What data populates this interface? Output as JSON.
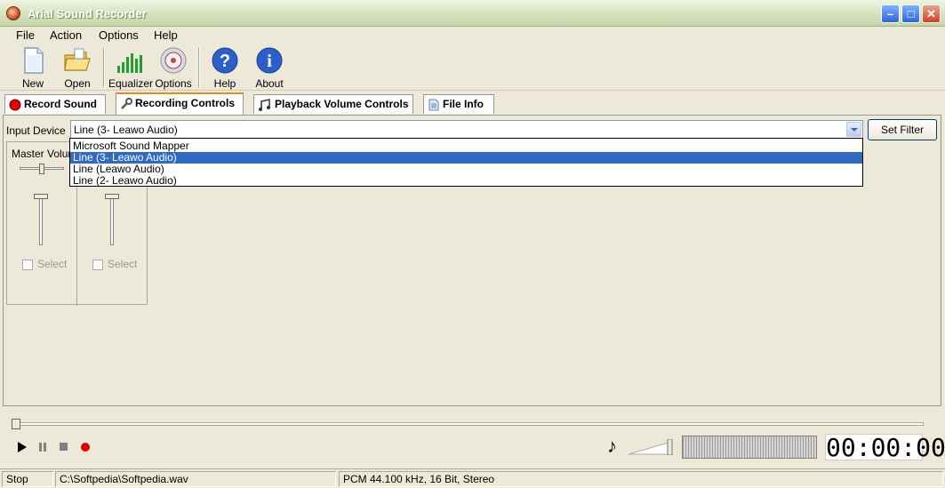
{
  "window": {
    "title": "Arial Sound Recorder"
  },
  "menu": {
    "file": "File",
    "action": "Action",
    "options": "Options",
    "help": "Help"
  },
  "toolbar": {
    "new": "New",
    "open": "Open",
    "equalizer": "Equalizer",
    "options": "Options",
    "help": "Help",
    "about": "About"
  },
  "tabs": {
    "record_sound": "Record Sound",
    "recording_controls": "Recording Controls",
    "playback_volume": "Playback Volume Controls",
    "file_info": "File Info"
  },
  "recording": {
    "input_device_label": "Input Device",
    "input_device_value": "Line (3- Leawo Audio)",
    "set_filter": "Set Filter",
    "master_volume": "Master Volume",
    "select1": "Select",
    "select2": "Select",
    "devices": [
      "Microsoft Sound Mapper",
      "Line (3- Leawo Audio)",
      "Line (Leawo Audio)",
      "Line (2- Leawo Audio)"
    ]
  },
  "player": {
    "time": "00:00:00"
  },
  "status": {
    "state": "Stop",
    "file": "C:\\Softpedia\\Softpedia.wav",
    "format": "PCM 44.100 kHz, 16 Bit, Stereo"
  },
  "colors": {
    "selection": "#316ac5",
    "record": "#e00000",
    "tab_active": "#e68b2c"
  }
}
